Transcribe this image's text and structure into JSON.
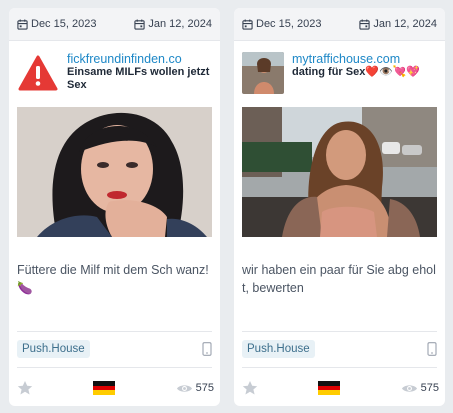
{
  "cards": [
    {
      "date_start": "Dec 15, 2023",
      "date_end": "Jan 12, 2024",
      "domain": "fickfreundinfinden.co",
      "title": "Einsame MILFs wollen jetzt Sex",
      "thumb_icon": "warning-icon",
      "image": "woman-portrait",
      "description": "Füttere die Milf mit dem Sch wanz! 🍆",
      "network": "Push.House",
      "device_icon": "mobile-icon",
      "country_flag": "germany-flag-icon",
      "views": "575"
    },
    {
      "date_start": "Dec 15, 2023",
      "date_end": "Jan 12, 2024",
      "domain": "mytraffichouse.com",
      "title": "dating für Sex❤️👁️💘💖",
      "thumb_icon": "woman-thumbnail",
      "image": "woman-street-photo",
      "description": "wir haben ein paar für Sie abg eholt, bewerten",
      "network": "Push.House",
      "device_icon": "mobile-icon",
      "country_flag": "germany-flag-icon",
      "views": "575"
    }
  ],
  "colors": {
    "domain": "#1e88c7",
    "badge_bg": "#e8f1f6",
    "warning": "#e53935",
    "background": "#e9ecef"
  }
}
